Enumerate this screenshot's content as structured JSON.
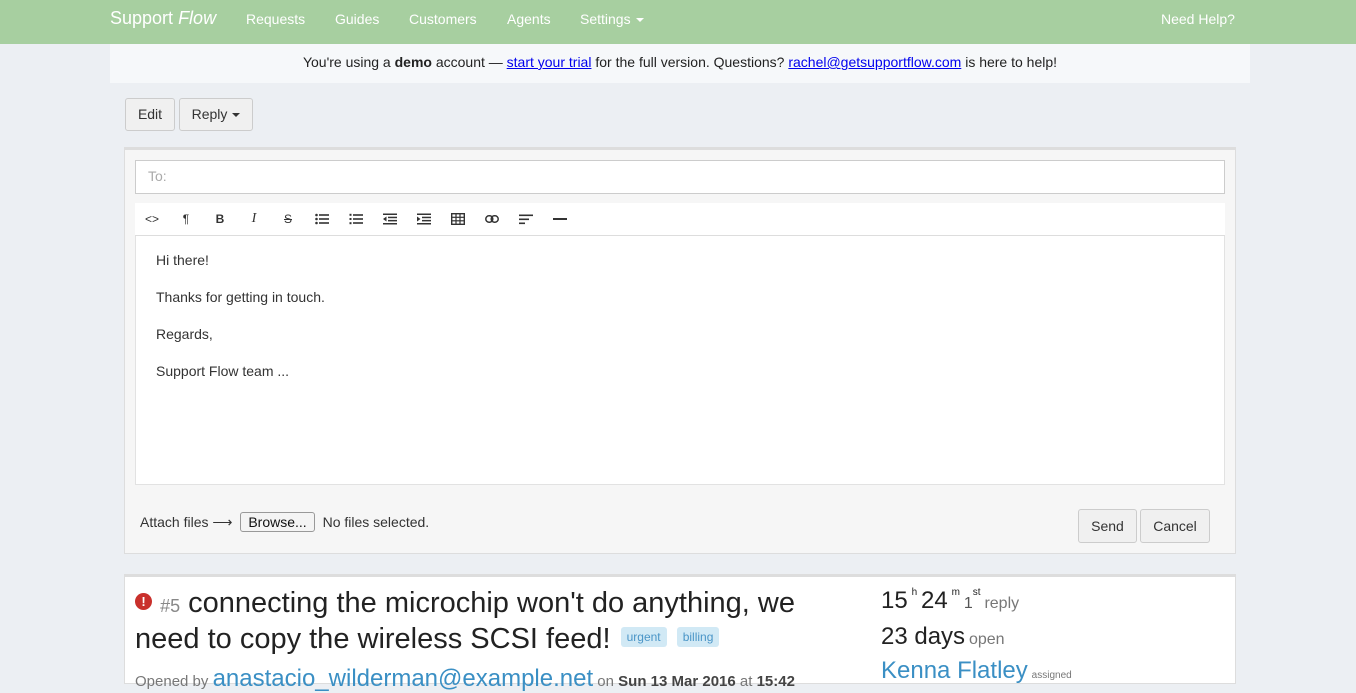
{
  "navbar": {
    "brand_main": "Support",
    "brand_italic": "Flow",
    "items": [
      "Requests",
      "Guides",
      "Customers",
      "Agents",
      "Settings"
    ],
    "help": "Need Help?"
  },
  "banner": {
    "t1": "You're using a ",
    "bold": "demo",
    "t2": " account — ",
    "trial_link": "start your trial",
    "t3": " for the full version. Questions? ",
    "email_link": "rachel@getsupportflow.com",
    "t4": " is here to help!"
  },
  "actions": {
    "edit": "Edit",
    "reply": "Reply"
  },
  "composer": {
    "to_placeholder": "To:",
    "toolbar": [
      "code-view-icon",
      "paragraph-icon",
      "bold-icon",
      "italic-icon",
      "strikethrough-icon",
      "unordered-list-icon",
      "ordered-list-icon",
      "outdent-icon",
      "indent-icon",
      "table-icon",
      "link-icon",
      "align-icon",
      "horizontal-rule-icon"
    ],
    "body": [
      "Hi there!",
      "Thanks for getting in touch.",
      "Regards,",
      "Support Flow team ..."
    ],
    "attach_label": "Attach files ⟶",
    "browse": "Browse...",
    "no_files": "No files selected.",
    "send": "Send",
    "cancel": "Cancel"
  },
  "ticket": {
    "number": "#5",
    "title": "connecting the microchip won't do anything, we need to copy the wireless SCSI feed!",
    "labels": [
      "urgent",
      "billing"
    ],
    "opened_by": "Opened by ",
    "opener": "anastacio_wilderman@example.net",
    "on": " on ",
    "date": "Sun 13 Mar 2016",
    "at": " at ",
    "time": "15:42",
    "stats": {
      "hours": "15",
      "h": "h",
      "minutes": "24",
      "m": "m",
      "replies": "1",
      "st": "st",
      "reply": "reply",
      "days": "23 days",
      "open": "open",
      "assignee": "Kenna Flatley",
      "assigned": "assigned"
    }
  }
}
